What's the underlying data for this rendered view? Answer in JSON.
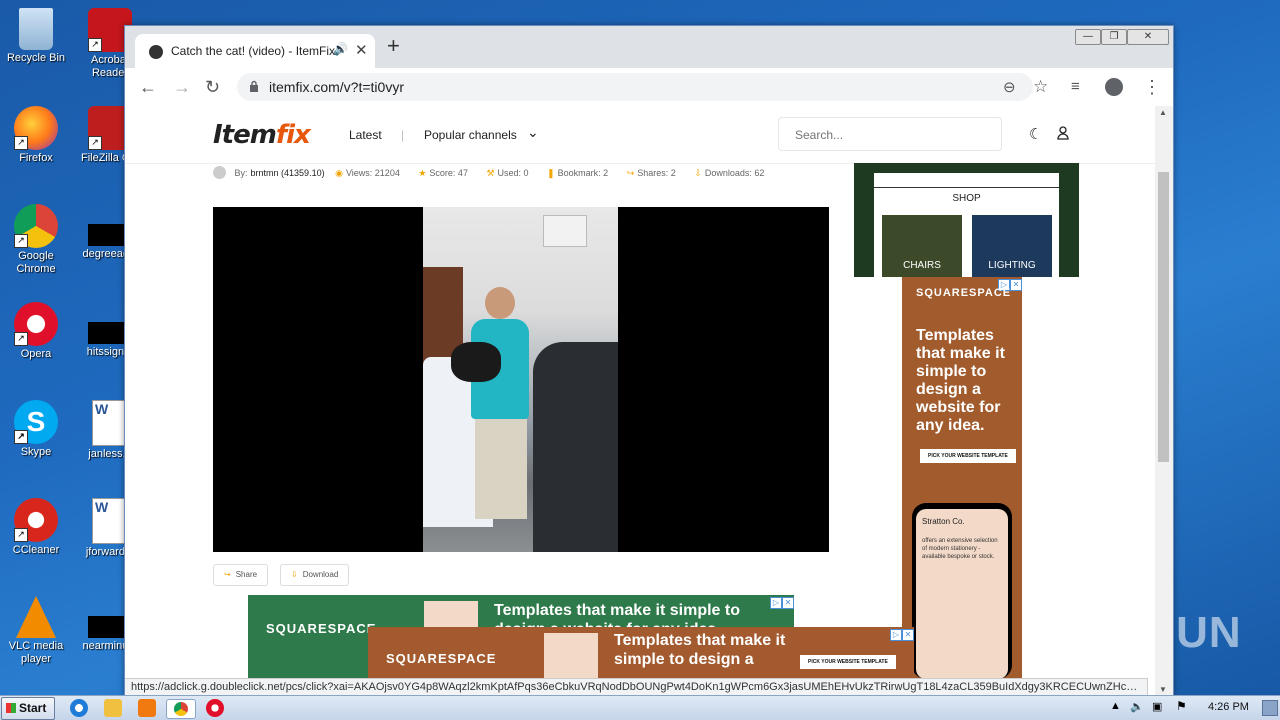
{
  "desktop": {
    "icons": [
      {
        "label": "Recycle Bin"
      },
      {
        "label": "Acrobat Reader"
      },
      {
        "label": "Firefox"
      },
      {
        "label": "FileZilla C..."
      },
      {
        "label": "Google Chrome"
      },
      {
        "label": "degreeac..."
      },
      {
        "label": "Opera"
      },
      {
        "label": "hitssign..."
      },
      {
        "label": "Skype"
      },
      {
        "label": "janless..."
      },
      {
        "label": "CCleaner"
      },
      {
        "label": "jforward..."
      },
      {
        "label": "VLC media player"
      },
      {
        "label": "nearminu..."
      }
    ],
    "watermark": "ANY RUN"
  },
  "browser": {
    "tab_title": "Catch the cat! (video) - ItemFix",
    "url": "itemfix.com/v?t=ti0vyr",
    "status_url": "https://adclick.g.doubleclick.net/pcs/click?xai=AKAOjsv0YG4p8WAqzl2kmKptAfPqs36eCbkuVRqNodDbOUNgPwt4DoKn1gWPcm6Gx3jasUMEhEHvUkzTRirwUgT18L4zaCL359BuIdXdgy3KRCECUwnZHc_KZ4jvsU..."
  },
  "site": {
    "logo_item": "Item",
    "logo_fix": "fix",
    "nav_latest": "Latest",
    "nav_separator": "|",
    "nav_popular": "Popular channels",
    "search_placeholder": "Search..."
  },
  "meta": {
    "by": "By:",
    "author": "brntmn (41359.10)",
    "views": "Views: 21204",
    "score": "Score: 47",
    "used": "Used: 0",
    "bookmark": "Bookmark: 2",
    "shares": "Shares: 2",
    "downloads": "Downloads: 62"
  },
  "actions": {
    "share": "Share",
    "download": "Download"
  },
  "ads": {
    "shop_title": "SHOP",
    "chairs": "CHAIRS",
    "lighting": "LIGHTING",
    "brand": "SQUARESPACE",
    "tagline": "Templates that make it simple to design a website for any idea.",
    "pick_cta": "PICK YOUR WEBSITE TEMPLATE",
    "phone_brand": "Stratton Co.",
    "phone_text": "offers an extensive selection of modern stationery - available bespoke or stock.",
    "banner_headline": "Templates that make it simple to design a website for any idea",
    "banner_headline2": "Templates that make it simple to design a"
  },
  "taskbar": {
    "start": "Start",
    "clock": "4:26 PM"
  }
}
